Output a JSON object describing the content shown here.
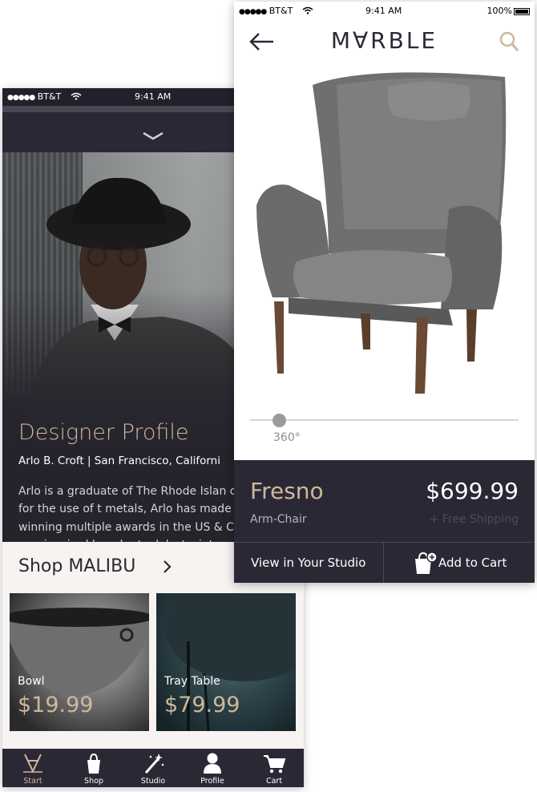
{
  "back_screen": {
    "status_bar": {
      "signal": "●●●●●",
      "carrier": "BT&T",
      "wifi": "wifi-icon",
      "time": "9:41 AM"
    },
    "designer": {
      "title": "Designer Profile",
      "subtitle": "Arlo B. Croft | San Francisco, Californi",
      "bio": "Arlo is a graduate of The Rhode Islan of design. Best known for the use of t metals, Arlo has made a name for him winning multiple awards in the US & C MALIBU Collection was inspired by a he took last winter along the Californ"
    },
    "shop": {
      "label": "Shop MALIBU"
    },
    "products": [
      {
        "name": "Bowl",
        "price": "$19.99"
      },
      {
        "name": "Tray Table",
        "price": "$79.99"
      }
    ],
    "tabs": [
      {
        "label": "Start",
        "icon": "marble-logo-icon"
      },
      {
        "label": "Shop",
        "icon": "shopping-bag-icon"
      },
      {
        "label": "Studio",
        "icon": "magic-wand-icon"
      },
      {
        "label": "Profile",
        "icon": "user-icon"
      },
      {
        "label": "Cart",
        "icon": "cart-icon"
      }
    ]
  },
  "front_screen": {
    "status_bar": {
      "signal": "●●●●●",
      "carrier": "BT&T",
      "time": "9:41 AM",
      "battery": "100%"
    },
    "header": {
      "brand": "M∀RBLE"
    },
    "viewer": {
      "rotation_label": "360°",
      "rotation_position": 0.11
    },
    "product": {
      "name": "Fresno",
      "category": "Arm-Chair",
      "price": "$699.99",
      "shipping": "+ Free Shipping"
    },
    "actions": {
      "studio_label": "View in Your Studio",
      "cart_label": "Add to Cart"
    }
  },
  "colors": {
    "accent": "#cdb89a",
    "dark": "#2b2836",
    "light": "#f6f3f1"
  }
}
